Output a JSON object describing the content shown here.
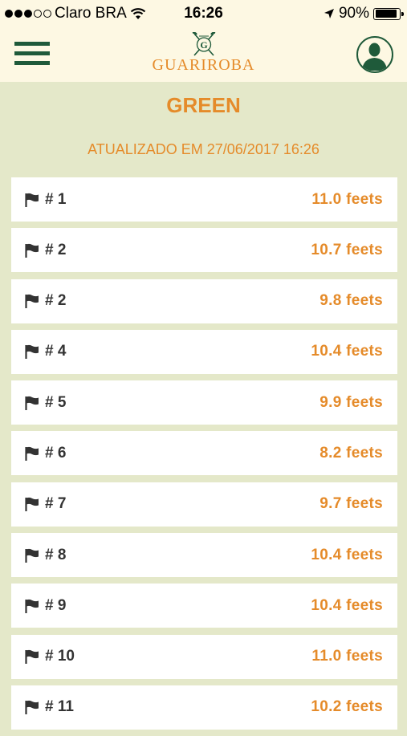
{
  "status_bar": {
    "carrier": "Claro BRA",
    "time": "16:26",
    "battery_percent": "90%",
    "battery_level": 0.9,
    "signal_dots_filled": 3
  },
  "header": {
    "logo_text": "GUARIROBA",
    "menu_icon": "hamburger-menu-icon",
    "profile_icon": "user-avatar-icon"
  },
  "page": {
    "title": "GREEN",
    "updated": "ATUALIZADO EM 27/06/2017 16:26"
  },
  "holes": [
    {
      "label": "# 1",
      "value": "11.0 feets"
    },
    {
      "label": "# 2",
      "value": "10.7 feets"
    },
    {
      "label": "# 2",
      "value": "9.8 feets"
    },
    {
      "label": "# 4",
      "value": "10.4 feets"
    },
    {
      "label": "# 5",
      "value": "9.9 feets"
    },
    {
      "label": "# 6",
      "value": "8.2 feets"
    },
    {
      "label": "# 7",
      "value": "9.7 feets"
    },
    {
      "label": "# 8",
      "value": "10.4 feets"
    },
    {
      "label": "# 9",
      "value": "10.4 feets"
    },
    {
      "label": "# 10",
      "value": "11.0 feets"
    },
    {
      "label": "# 11",
      "value": "10.2 feets"
    }
  ],
  "colors": {
    "accent": "#e58b2a",
    "brand_green": "#1f5a3a",
    "background": "#e4e8c9",
    "header_bg": "#fdf8e3"
  }
}
